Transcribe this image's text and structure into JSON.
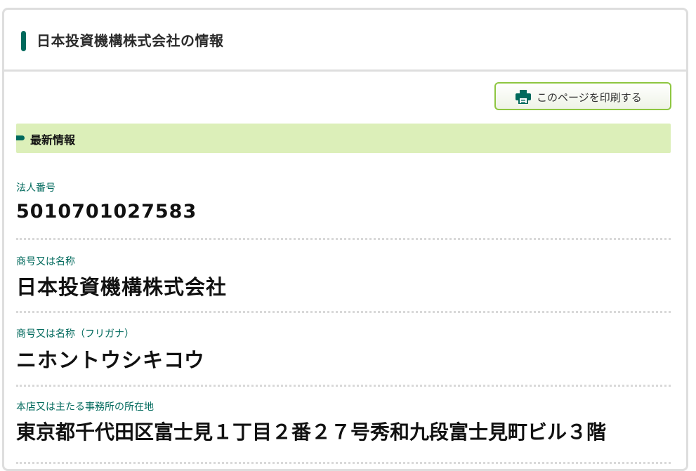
{
  "header": {
    "title": "日本投資機構株式会社の情報"
  },
  "toolbar": {
    "print_label": "このページを印刷する",
    "print_icon": "printer-icon"
  },
  "section": {
    "title": "最新情報"
  },
  "fields": [
    {
      "label": "法人番号",
      "value": "5010701027583"
    },
    {
      "label": "商号又は名称",
      "value": "日本投資機構株式会社"
    },
    {
      "label": "商号又は名称（フリガナ）",
      "value": "ニホントウシキコウ"
    },
    {
      "label": "本店又は主たる事務所の所在地",
      "value": "東京都千代田区富士見１丁目２番２７号秀和九段富士見町ビル３階"
    }
  ],
  "colors": {
    "accent": "#00695c",
    "section_bg": "#dcefb9",
    "button_border": "#8ec641"
  }
}
